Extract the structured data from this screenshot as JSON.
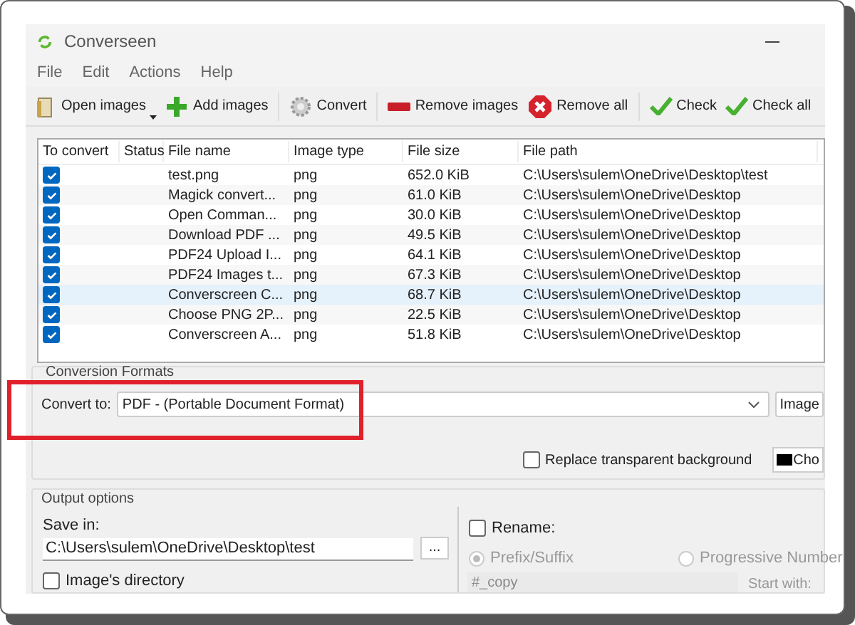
{
  "window": {
    "title": "Converseen"
  },
  "menu": [
    "File",
    "Edit",
    "Actions",
    "Help"
  ],
  "toolbar": [
    {
      "kind": "open",
      "label": "Open images"
    },
    {
      "kind": "add",
      "label": "Add images"
    },
    {
      "kind": "convert",
      "label": "Convert"
    },
    {
      "kind": "remove",
      "label": "Remove images"
    },
    {
      "kind": "removeall",
      "label": "Remove all"
    },
    {
      "kind": "check",
      "label": "Check"
    },
    {
      "kind": "check",
      "label": "Check all"
    }
  ],
  "table": {
    "columns": [
      "To convert",
      "Status",
      "File name",
      "Image type",
      "File size",
      "File path"
    ],
    "rows": [
      {
        "checked": true,
        "selected": false,
        "name": "test.png",
        "type": "png",
        "size": "652.0 KiB",
        "path": "C:\\Users\\sulem\\OneDrive\\Desktop\\test"
      },
      {
        "checked": true,
        "selected": false,
        "name": "Magick convert...",
        "type": "png",
        "size": "61.0 KiB",
        "path": "C:\\Users\\sulem\\OneDrive\\Desktop"
      },
      {
        "checked": true,
        "selected": false,
        "name": "Open Comman...",
        "type": "png",
        "size": "30.0 KiB",
        "path": "C:\\Users\\sulem\\OneDrive\\Desktop"
      },
      {
        "checked": true,
        "selected": false,
        "name": "Download PDF ...",
        "type": "png",
        "size": "49.5 KiB",
        "path": "C:\\Users\\sulem\\OneDrive\\Desktop"
      },
      {
        "checked": true,
        "selected": false,
        "name": "PDF24 Upload I...",
        "type": "png",
        "size": "64.1 KiB",
        "path": "C:\\Users\\sulem\\OneDrive\\Desktop"
      },
      {
        "checked": true,
        "selected": false,
        "name": "PDF24 Images t...",
        "type": "png",
        "size": "67.3 KiB",
        "path": "C:\\Users\\sulem\\OneDrive\\Desktop"
      },
      {
        "checked": true,
        "selected": true,
        "name": "Converscreen C...",
        "type": "png",
        "size": "68.7 KiB",
        "path": "C:\\Users\\sulem\\OneDrive\\Desktop"
      },
      {
        "checked": true,
        "selected": false,
        "name": "Choose PNG 2P...",
        "type": "png",
        "size": "22.5 KiB",
        "path": "C:\\Users\\sulem\\OneDrive\\Desktop"
      },
      {
        "checked": true,
        "selected": false,
        "name": "Converscreen A...",
        "type": "png",
        "size": "51.8 KiB",
        "path": "C:\\Users\\sulem\\OneDrive\\Desktop"
      }
    ]
  },
  "conversion_formats": {
    "title": "Conversion Formats",
    "label": "Convert to:",
    "value": "PDF - (Portable Document Format)",
    "image_button": "Image",
    "replace_background": {
      "label": "Replace transparent background",
      "checked": false
    },
    "color_button": "Cho"
  },
  "output_options": {
    "title": "Output options",
    "save_in_label": "Save in:",
    "save_in_value": "C:\\Users\\sulem\\OneDrive\\Desktop\\test",
    "browse_button": "...",
    "images_directory": {
      "label": "Image's directory",
      "checked": false
    },
    "rename": {
      "label": "Rename:",
      "checked": false
    },
    "modes": [
      {
        "label": "Prefix/Suffix",
        "selected": true
      },
      {
        "label": "Progressive Number",
        "selected": false
      }
    ],
    "pattern_value": "#_copy",
    "start_with_label": "Start with:"
  }
}
